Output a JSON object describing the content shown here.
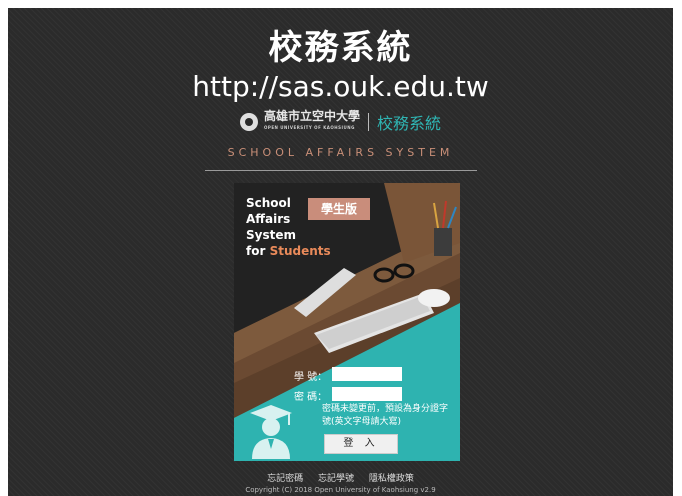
{
  "header": {
    "title": "校務系統",
    "url": "http://sas.ouk.edu.tw",
    "university_name": "高雄市立空中大學",
    "university_name_en": "OPEN UNIVERSITY OF KAOHSIUNG",
    "system_name": "校務系統",
    "subtitle": "SCHOOL AFFAIRS SYSTEM"
  },
  "card": {
    "line1": "School",
    "line2": "Affairs",
    "line3": "System",
    "line4_prefix": "for ",
    "line4_accent": "Students",
    "badge": "學生版"
  },
  "form": {
    "student_id_label": "學 號：",
    "password_label": "密 碼：",
    "hint": "密碼未變更前，預設為身分證字號(英文字母請大寫)",
    "login_button": "登 入"
  },
  "footer": {
    "forgot_password": "忘記密碼",
    "forgot_student_id": "忘記學號",
    "privacy_policy": "隱私權政策",
    "copyright": "Copyright (C) 2018 Open University of Kaohsiung v2.9"
  },
  "colors": {
    "background": "#2b2b2b",
    "accent_teal": "#2eb3b0",
    "badge": "#c98d7b",
    "subtitle": "#c98f78"
  }
}
